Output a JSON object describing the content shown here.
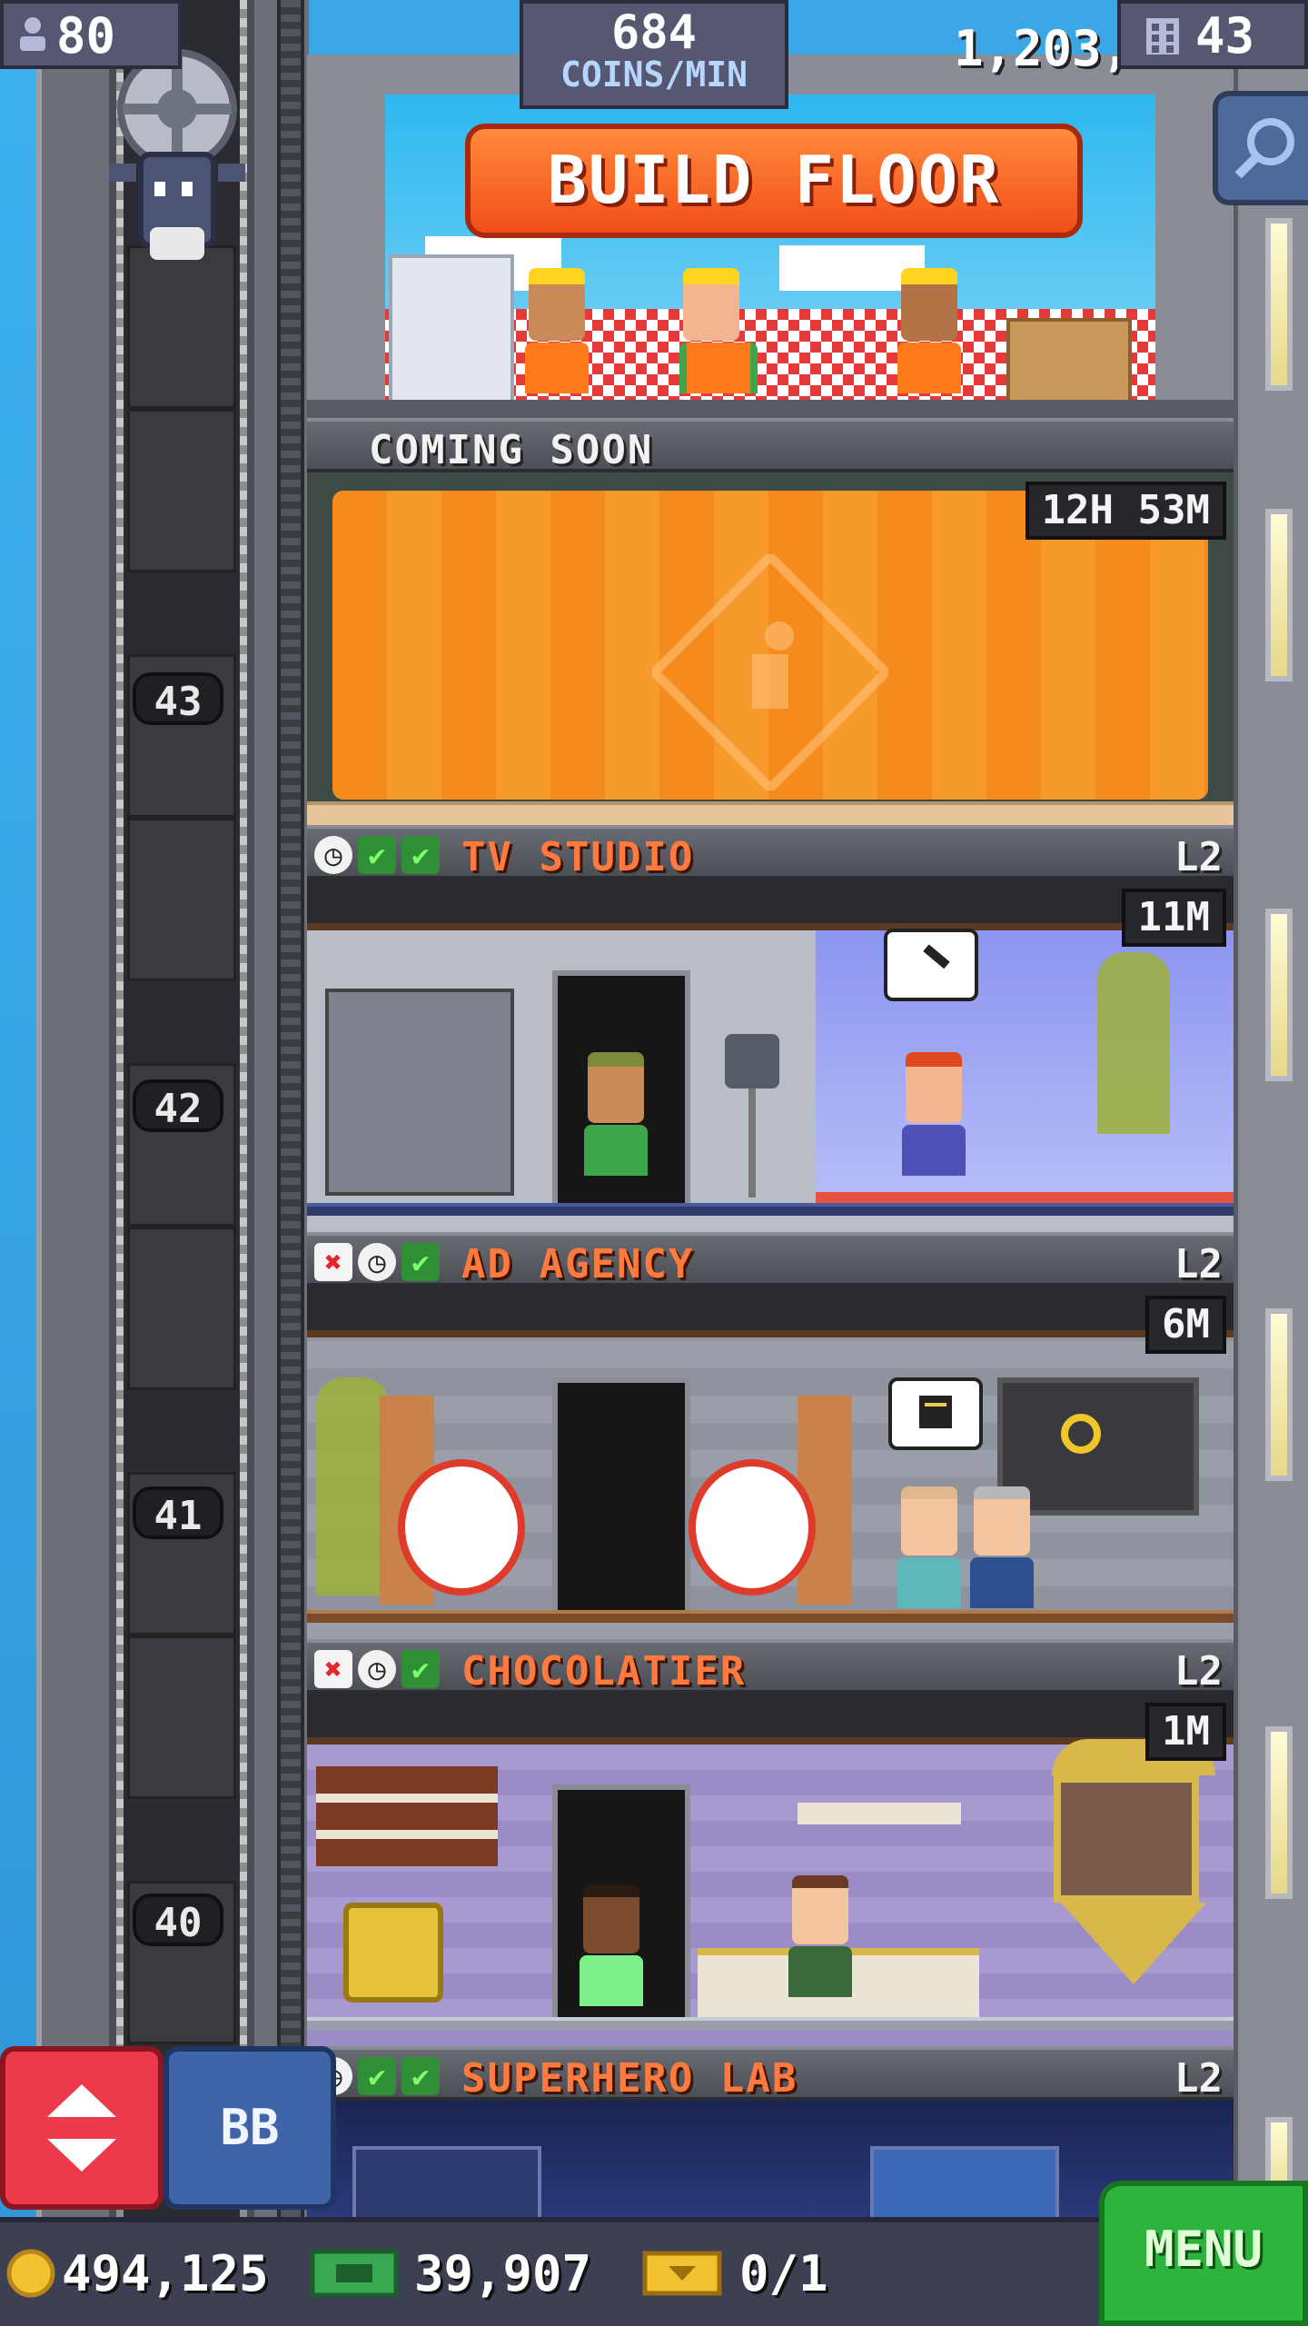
{
  "hud": {
    "population": "80",
    "coins_per_min_value": "684",
    "coins_per_min_label": "COINS/MIN",
    "tower_bux_partial": "1,203,",
    "floor_count": "43"
  },
  "build_floor": {
    "label": "BUILD FLOOR"
  },
  "construction_floor": {
    "title": "COMING SOON",
    "timer": "12H 53M"
  },
  "floors": [
    {
      "name": "TV STUDIO",
      "level": "L2",
      "timer": "11M",
      "number": "42"
    },
    {
      "name": "AD AGENCY",
      "level": "L2",
      "timer": "6M",
      "number": "41"
    },
    {
      "name": "CHOCOLATIER",
      "level": "L2",
      "timer": "1M",
      "number": "40"
    },
    {
      "name": "SUPERHERO LAB",
      "level": "L2"
    }
  ],
  "elevator_floor_numbers": [
    "43",
    "42",
    "41",
    "40"
  ],
  "controls": {
    "bb_label": "BB",
    "menu_label": "MENU"
  },
  "bottom_bar": {
    "coins": "494,125",
    "bux": "39,907",
    "tickets": "0/1"
  },
  "colors": {
    "floor_name_orange": "#ff7a3c",
    "build_button_orange": "#f4521e",
    "menu_green": "#2cb43d",
    "hud_purple": "#555870"
  }
}
